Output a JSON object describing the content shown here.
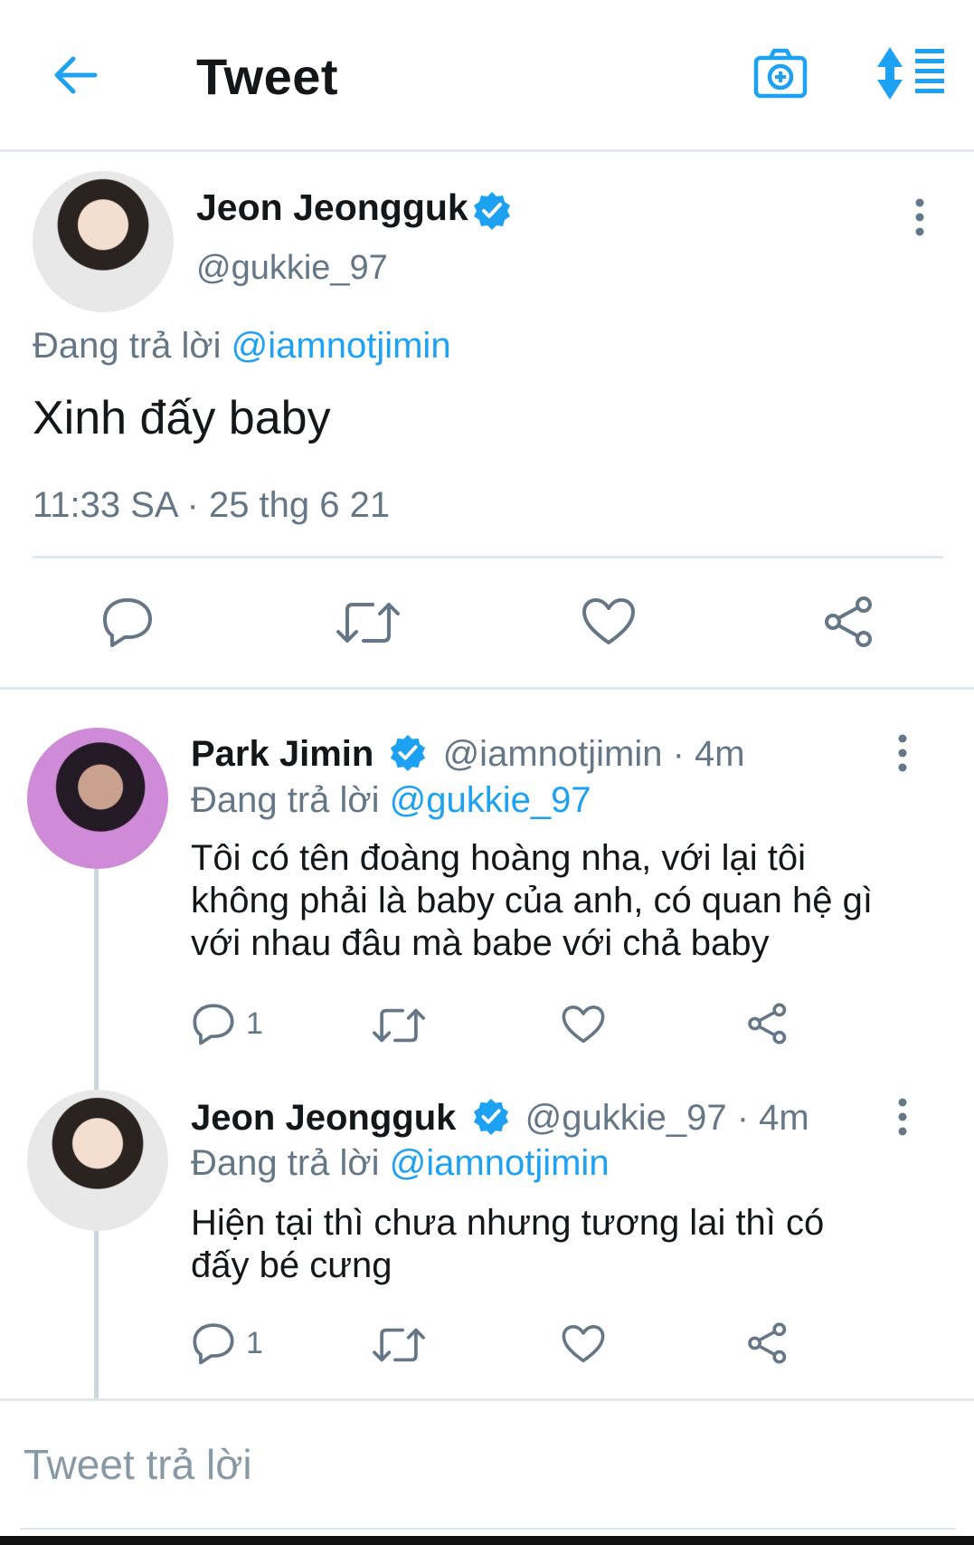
{
  "header": {
    "title": "Tweet",
    "back_icon": "arrow-left-icon",
    "camera_icon": "camera-plus-icon",
    "sort_icon": "sort-thread-icon"
  },
  "main_tweet": {
    "name": "Jeon Jeongguk",
    "handle": "@gukkie_97",
    "reply_prefix": "Đang trả lời",
    "reply_to": "@iamnotjimin",
    "text": "Xinh đấy baby",
    "timestamp": "11:33 SA · 25 thg 6 21"
  },
  "replies": [
    {
      "name": "Park Jimin",
      "meta": "@iamnotjimin · 4m",
      "reply_prefix": "Đang trả lời",
      "reply_to": "@gukkie_97",
      "text_lines": [
        "Tôi có tên đoàng hoàng nha, với lại tôi",
        "không phải là baby của anh, có quan hệ gì",
        "với nhau đâu mà babe với chả baby"
      ],
      "reply_count": "1"
    },
    {
      "name": "Jeon Jeongguk",
      "meta": "@gukkie_97 · 4m",
      "reply_prefix": "Đang trả lời",
      "reply_to": "@iamnotjimin",
      "text_lines": [
        "Hiện tại thì chưa nhưng tương lai thì có",
        "đấy bé cưng"
      ],
      "reply_count": "1"
    }
  ],
  "compose": {
    "placeholder": "Tweet trả lời"
  },
  "colors": {
    "accent": "#1da1f2",
    "text": "#14171a",
    "muted": "#657786",
    "divider": "#e1e8ed"
  }
}
